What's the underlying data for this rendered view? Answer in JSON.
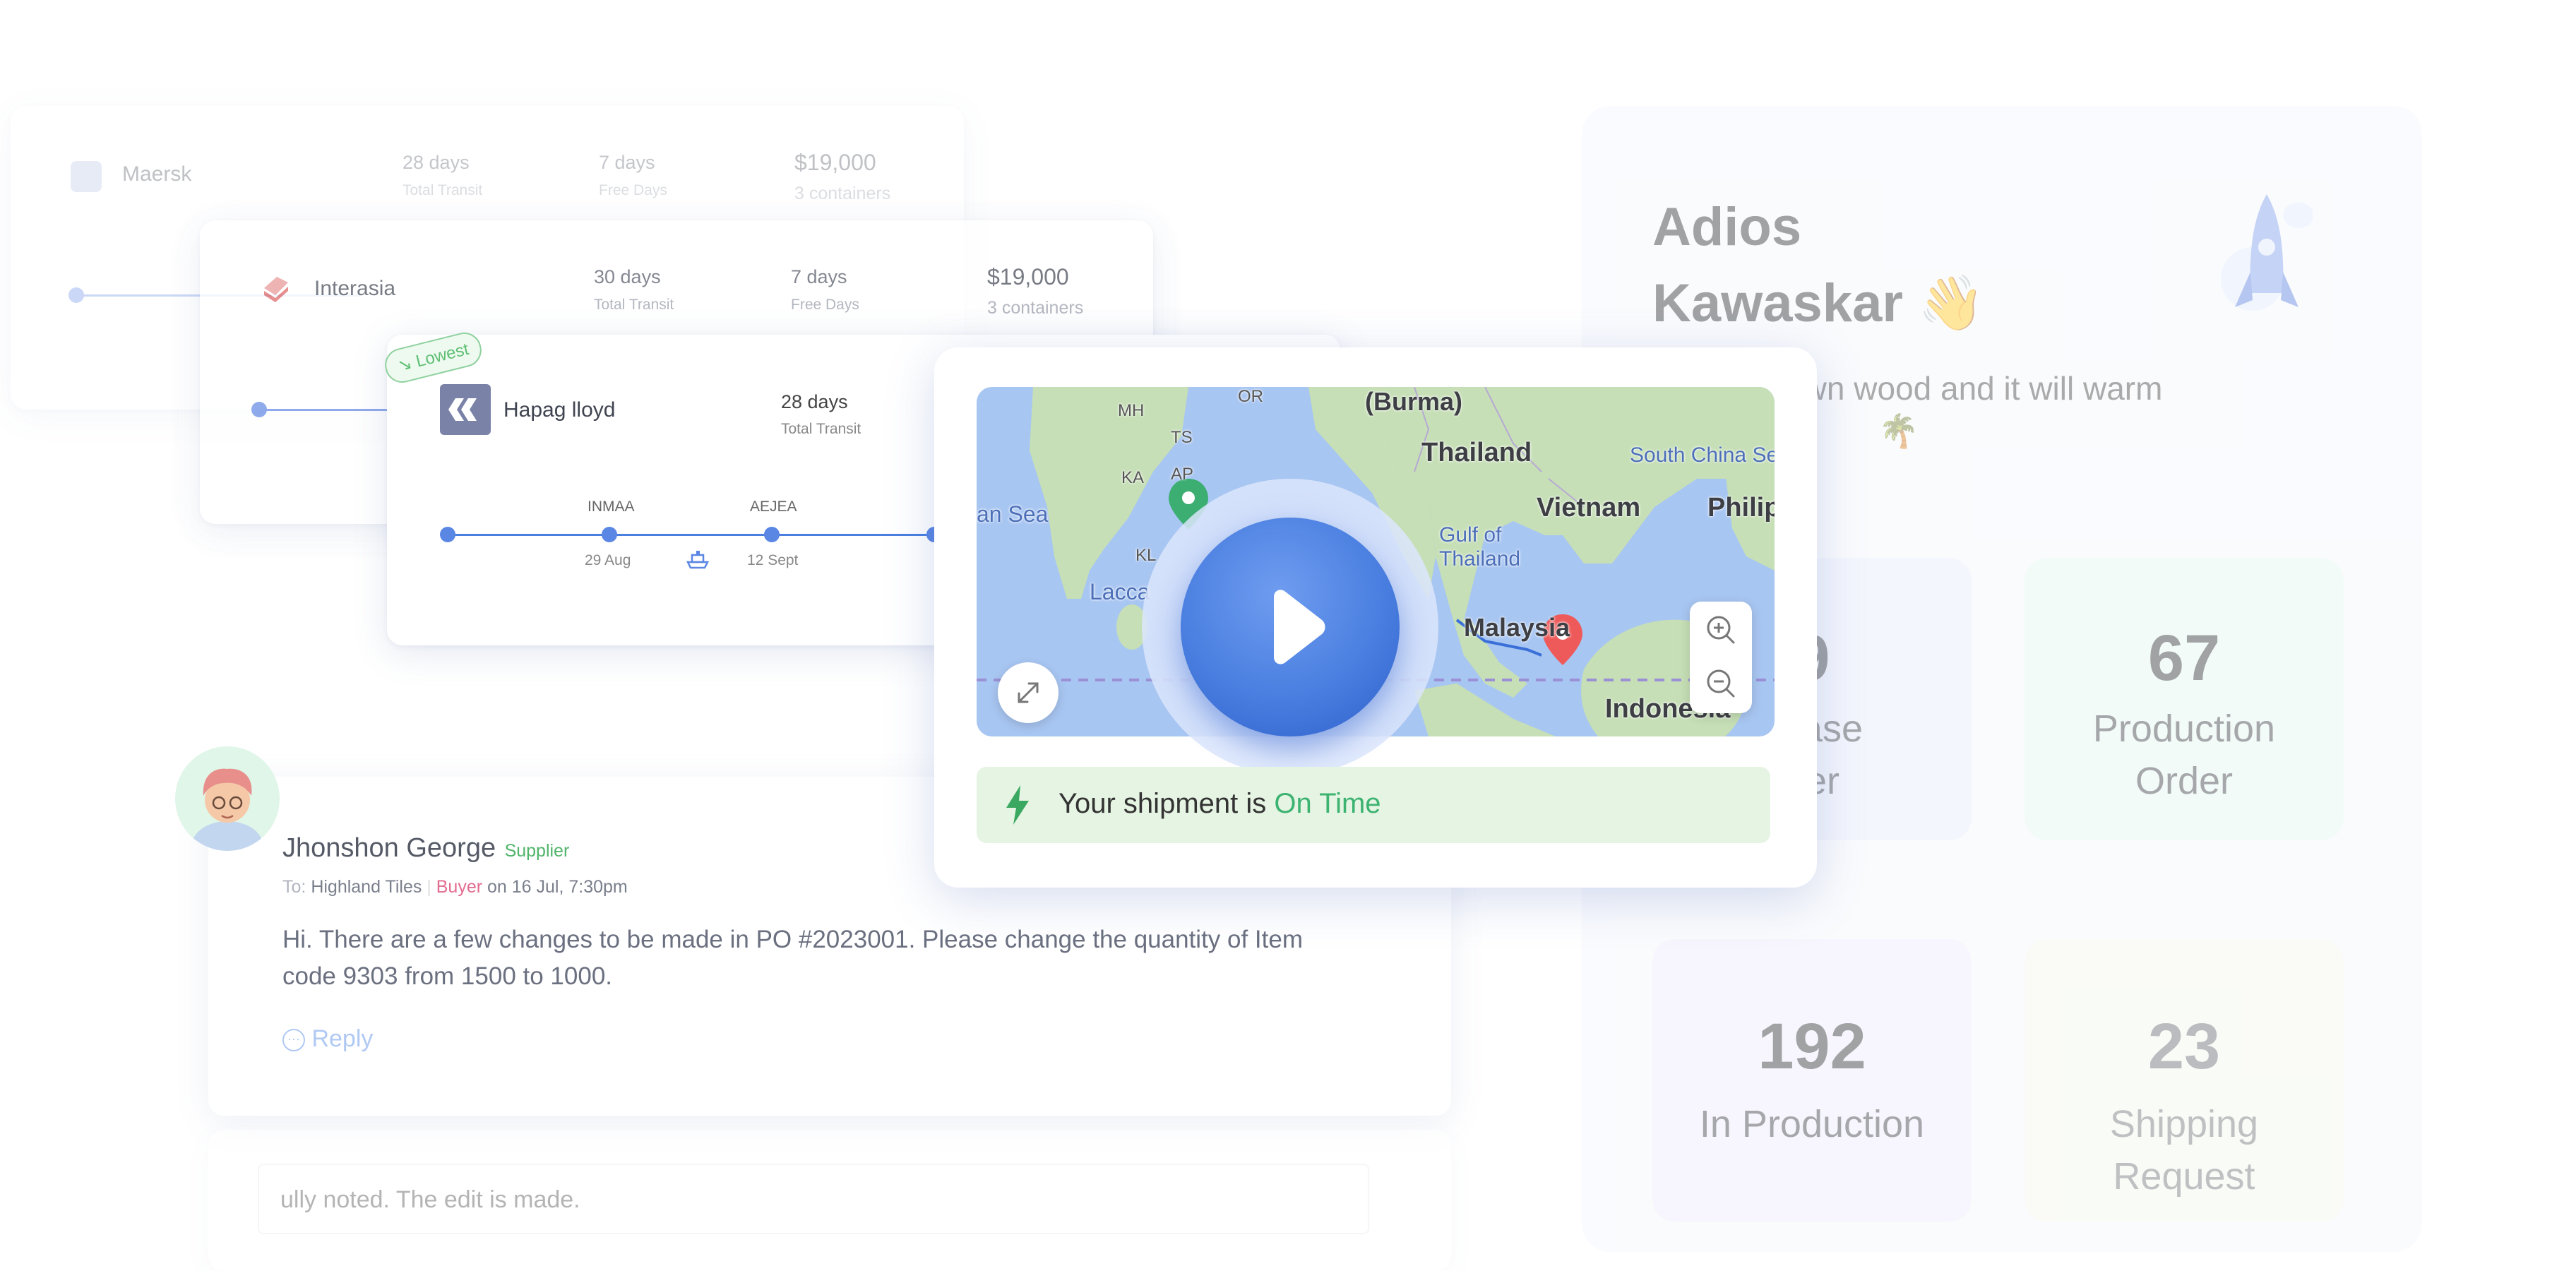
{
  "carriers": {
    "maersk": {
      "name": "Maersk",
      "transit": "28 days",
      "transit_label": "Total Transit",
      "free": "7 days",
      "free_label": "Free Days",
      "price": "$19,000",
      "containers": "3 containers"
    },
    "interasia": {
      "name": "Interasia",
      "transit": "30 days",
      "transit_label": "Total Transit",
      "free": "7 days",
      "free_label": "Free Days",
      "price": "$19,000",
      "containers": "3 containers"
    },
    "hapag": {
      "badge": "Lowest",
      "name": "Hapag lloyd",
      "transit": "28 days",
      "transit_label": "Total Transit",
      "stops": [
        {
          "code": "INMAA",
          "date": "29 Aug"
        },
        {
          "code": "AEJEA",
          "date": "12 Sept"
        }
      ]
    }
  },
  "map": {
    "labels": {
      "burma": "(Burma)",
      "thailand": "Thailand",
      "vietnam": "Vietnam",
      "malaysia": "Malaysia",
      "indonesia": "Indonesia",
      "south_china_sea": "South China Sea",
      "gulf_thailand": "Gulf of Thailand",
      "philippines": "Philip",
      "andaman": "an Sea",
      "laccadive": "Lacca",
      "mh": "MH",
      "or": "OR",
      "ts": "TS",
      "ka": "KA",
      "ap": "AP",
      "kl": "KL"
    },
    "play_icon": "play-icon",
    "expand_icon": "expand-icon",
    "zoom_in_icon": "zoom-in-icon",
    "zoom_out_icon": "zoom-out-icon"
  },
  "shipment_status": {
    "prefix": "Your shipment is",
    "status": "On Time",
    "icon": "lightning-icon",
    "status_color": "#3cb371"
  },
  "message": {
    "sender": "Jhonshon George",
    "role": "Supplier",
    "to_label": "To:",
    "recipient": "Highland Tiles",
    "recipient_role": "Buyer",
    "timestamp": "on 16 Jul, 7:30pm",
    "body": "Hi. There are a few changes to be made in PO #2023001. Please change the quantity of Item code 9303 from 1500 to 1000.",
    "reply": "Reply",
    "reply_input_value": "ully noted. The edit is made."
  },
  "dashboard": {
    "greeting_line1": "Adios",
    "greeting_line2": "Kawaskar",
    "greeting_emoji": "👋",
    "quote_line1": "r own wood and it will warm",
    "quote_emoji": "🌴",
    "stats": [
      {
        "value": "9",
        "label_line1": "chase",
        "label_line2": "der"
      },
      {
        "value": "67",
        "label_line1": "Production",
        "label_line2": "Order"
      },
      {
        "value": "192",
        "label_line1": "In Production",
        "label_line2": ""
      },
      {
        "value": "23",
        "label_line1": "Shipping",
        "label_line2": "Request"
      }
    ]
  },
  "colors": {
    "accent_blue": "#4a7fe0",
    "success_green": "#3cb371",
    "buyer_pink": "#e36b8f",
    "map_water": "#a8c6f2",
    "map_land": "#c6dfb6"
  }
}
